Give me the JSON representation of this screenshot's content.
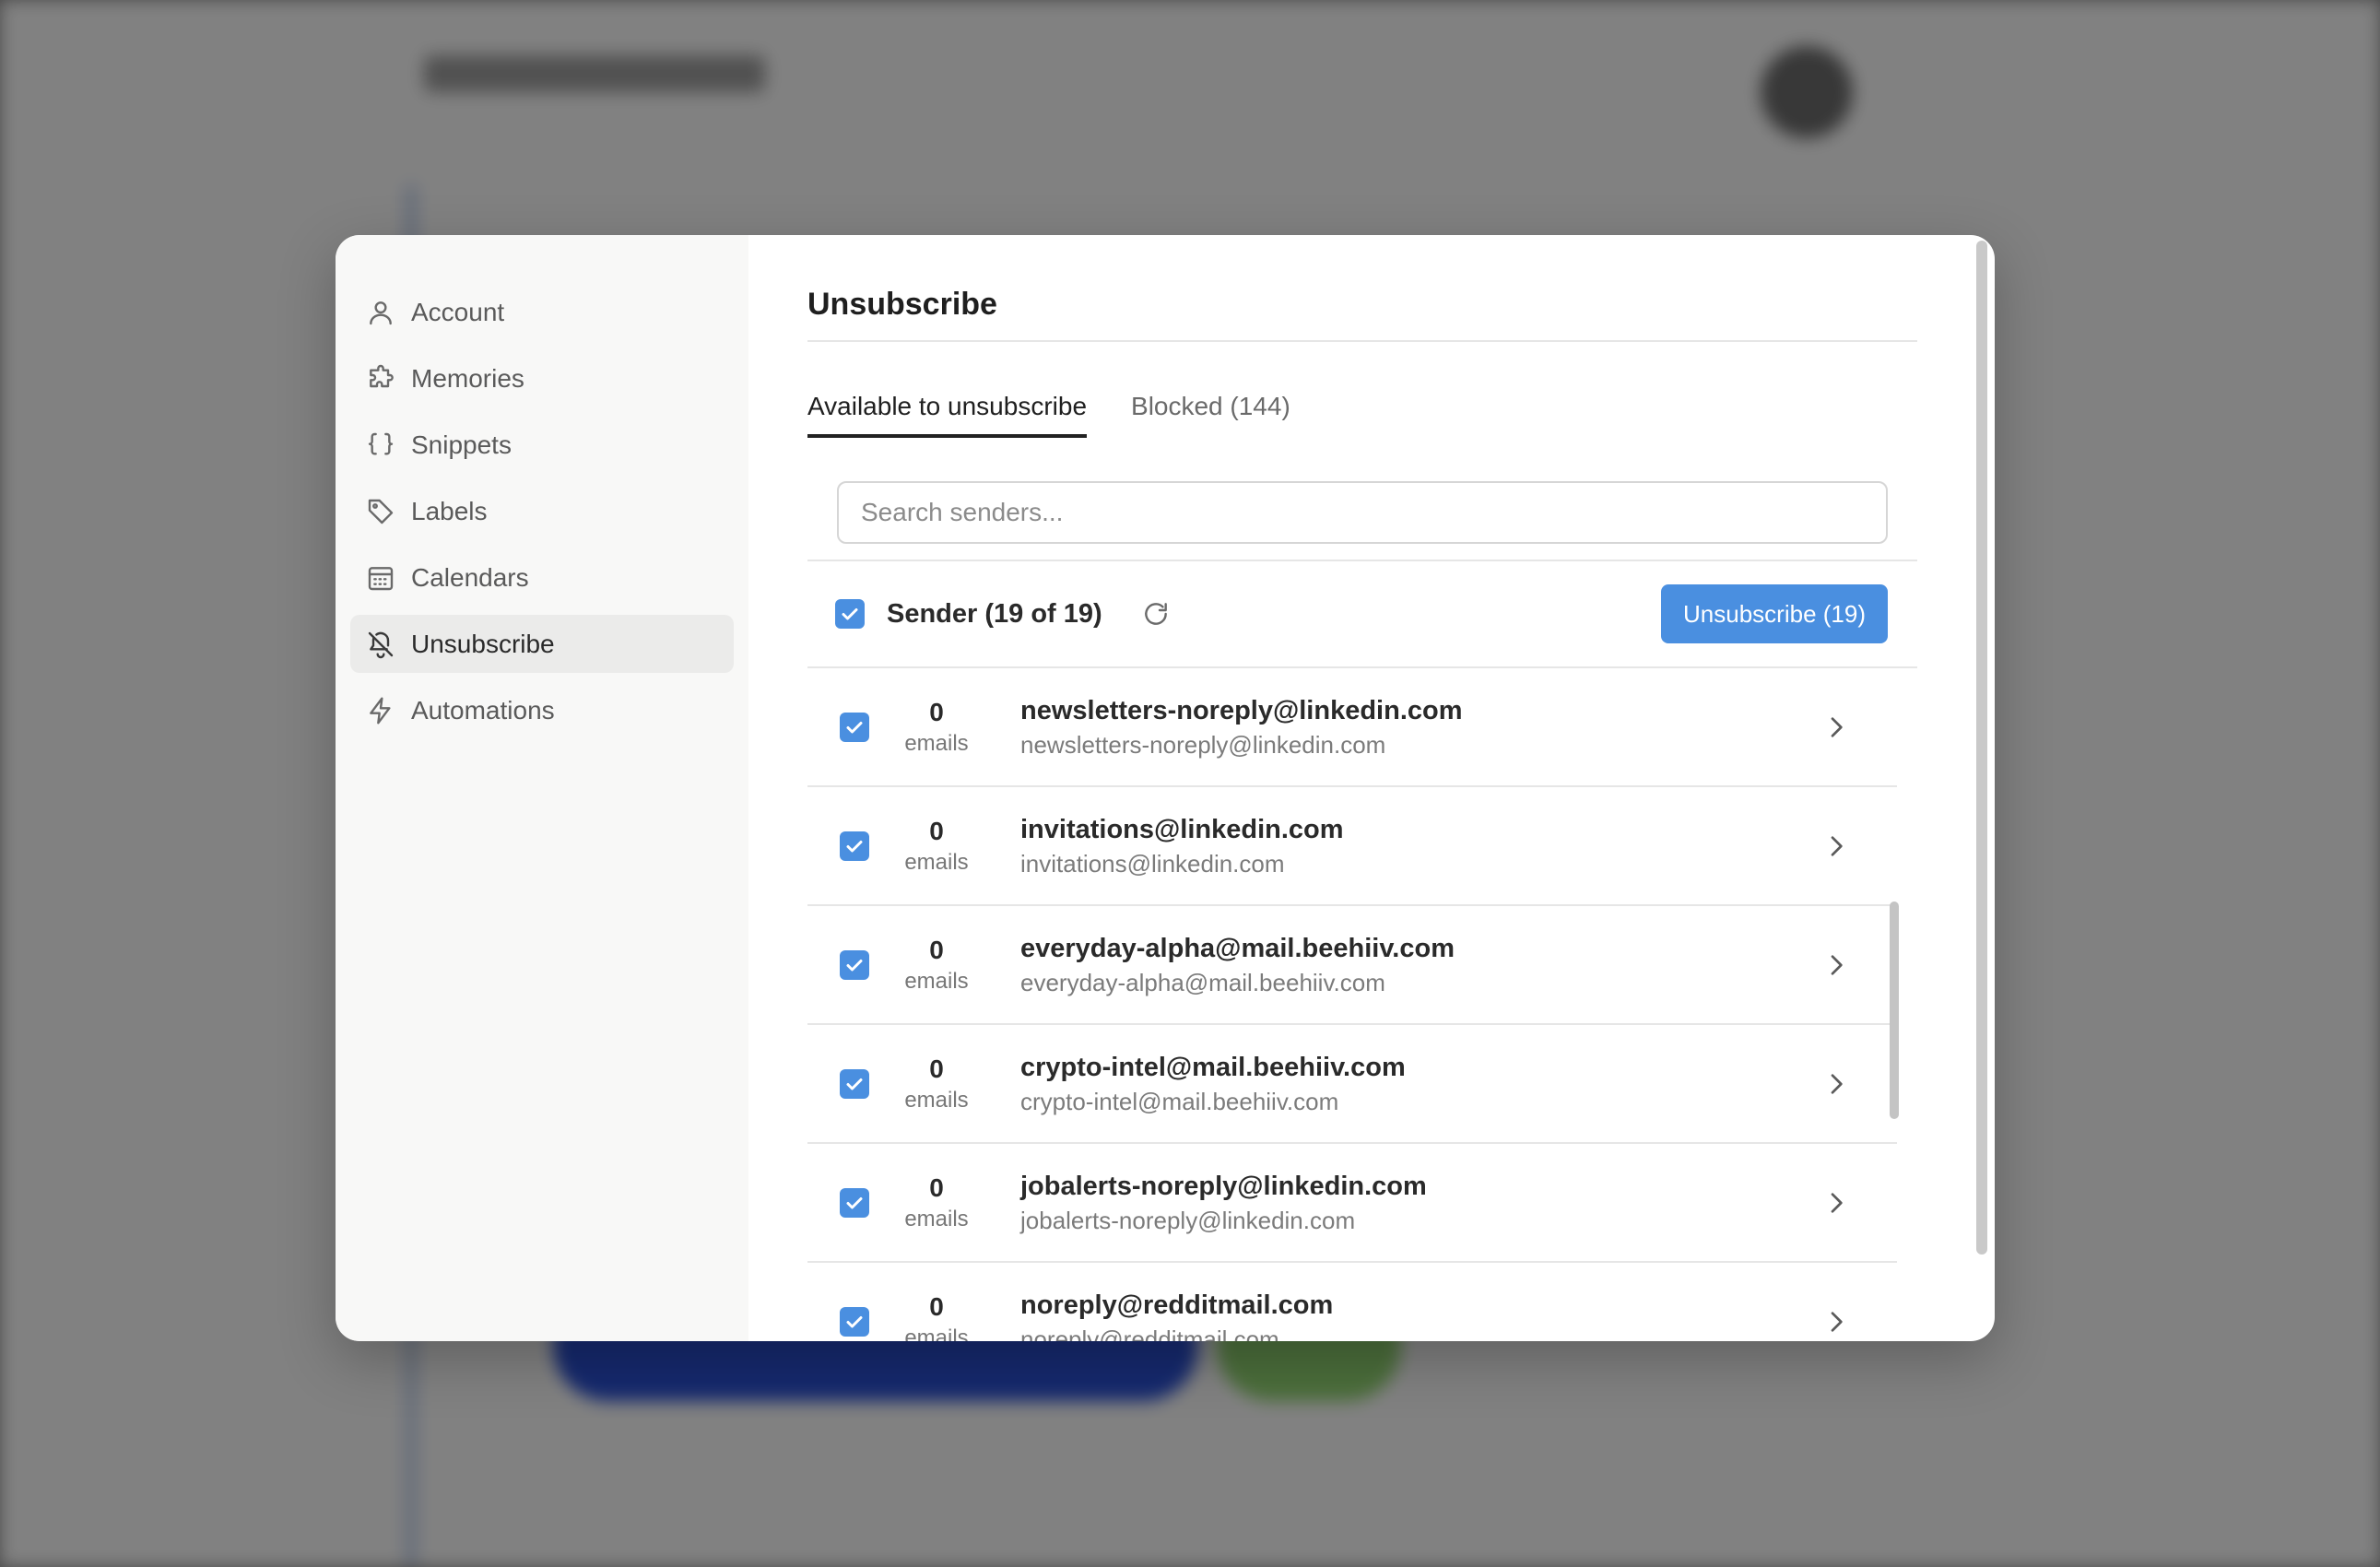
{
  "sidebar": {
    "items": [
      {
        "label": "Account",
        "icon": "user-icon"
      },
      {
        "label": "Memories",
        "icon": "puzzle-icon"
      },
      {
        "label": "Snippets",
        "icon": "braces-icon"
      },
      {
        "label": "Labels",
        "icon": "tag-icon"
      },
      {
        "label": "Calendars",
        "icon": "calendar-icon"
      },
      {
        "label": "Unsubscribe",
        "icon": "bell-off-icon",
        "active": true
      },
      {
        "label": "Automations",
        "icon": "bolt-icon"
      }
    ]
  },
  "main": {
    "title": "Unsubscribe",
    "tabs": [
      {
        "label": "Available to unsubscribe",
        "active": true
      },
      {
        "label": "Blocked (144)",
        "active": false
      }
    ],
    "search": {
      "placeholder": "Search senders...",
      "value": ""
    },
    "header": {
      "label": "Sender (19 of 19)",
      "unsubscribe_button": "Unsubscribe (19)"
    },
    "count_unit": "emails",
    "rows": [
      {
        "count": "0",
        "unit": "emails",
        "name": "newsletters-noreply@linkedin.com",
        "email": "newsletters-noreply@linkedin.com"
      },
      {
        "count": "0",
        "unit": "emails",
        "name": "invitations@linkedin.com",
        "email": "invitations@linkedin.com"
      },
      {
        "count": "0",
        "unit": "emails",
        "name": "everyday-alpha@mail.beehiiv.com",
        "email": "everyday-alpha@mail.beehiiv.com"
      },
      {
        "count": "0",
        "unit": "emails",
        "name": "crypto-intel@mail.beehiiv.com",
        "email": "crypto-intel@mail.beehiiv.com"
      },
      {
        "count": "0",
        "unit": "emails",
        "name": "jobalerts-noreply@linkedin.com",
        "email": "jobalerts-noreply@linkedin.com"
      },
      {
        "count": "0",
        "unit": "emails",
        "name": "noreply@redditmail.com",
        "email": "noreply@redditmail.com"
      }
    ]
  },
  "colors": {
    "accent": "#4a8fe0",
    "sidebar_bg": "#f8f8f7",
    "active_item_bg": "#ebebea"
  }
}
